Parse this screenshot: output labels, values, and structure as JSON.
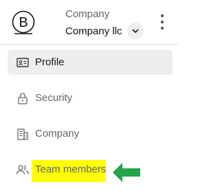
{
  "header": {
    "caption": "Company",
    "company_name": "Company llc",
    "logo": "B"
  },
  "icons": {
    "switcher": "chevron-down-icon",
    "menu": "kebab-menu-icon"
  },
  "nav": {
    "items": [
      {
        "label": "Profile",
        "icon": "id-card-icon",
        "active": true
      },
      {
        "label": "Security",
        "icon": "lock-icon",
        "active": false
      },
      {
        "label": "Company",
        "icon": "building-icon",
        "active": false
      },
      {
        "label": "Team members",
        "icon": "people-icon",
        "active": false
      }
    ]
  },
  "annotation": {
    "highlight_color": "#ffff00",
    "arrow_color": "#22a447"
  }
}
